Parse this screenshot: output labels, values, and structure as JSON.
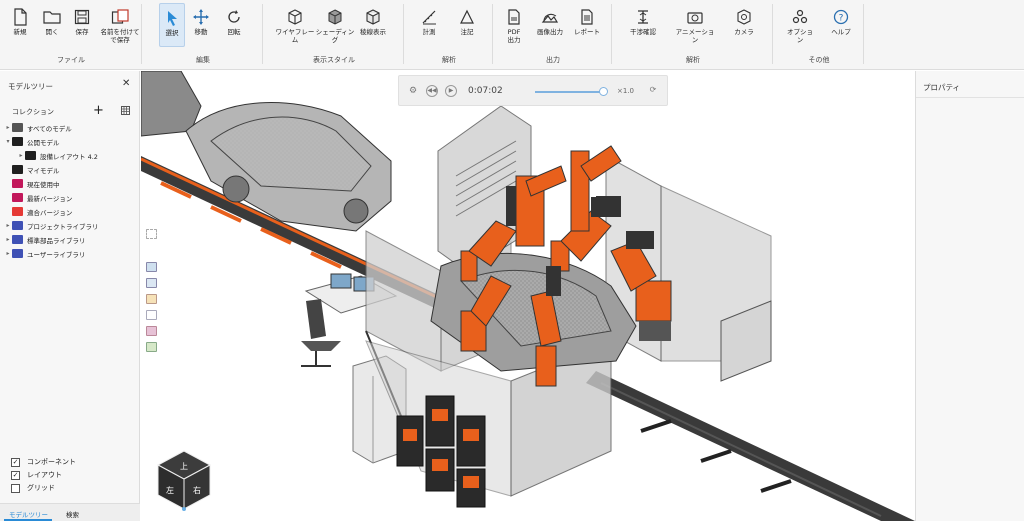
{
  "ribbon": {
    "groups": [
      {
        "label": "ファイル",
        "buttons": [
          {
            "label": "新規",
            "icon": "new-file-icon"
          },
          {
            "label": "開く",
            "icon": "open-folder-icon"
          },
          {
            "label": "保存",
            "icon": "save-icon"
          },
          {
            "label": "名前を付けて\nで保存",
            "icon": "save-as-icon"
          }
        ]
      },
      {
        "label": "編集",
        "buttons": [
          {
            "label": "選択",
            "icon": "select-arrow-icon"
          },
          {
            "label": "移動",
            "icon": "move-icon"
          },
          {
            "label": "回転",
            "icon": "rotate-icon"
          }
        ]
      },
      {
        "label": "表示スタイル",
        "buttons": [
          {
            "label": "ワイヤフレーム",
            "icon": "wireframe-cube-icon"
          },
          {
            "label": "シェーディング",
            "icon": "shaded-cube-icon"
          },
          {
            "label": "稜線表示",
            "icon": "edges-cube-icon"
          }
        ]
      },
      {
        "label": "解析",
        "buttons": [
          {
            "label": "計測",
            "icon": "measure-icon"
          },
          {
            "label": "注記",
            "icon": "annotation-icon"
          }
        ]
      },
      {
        "label": "出力",
        "buttons": [
          {
            "label": "PDF\n出力",
            "icon": "pdf-icon"
          },
          {
            "label": "画像出力",
            "icon": "image-export-icon"
          },
          {
            "label": "レポート",
            "icon": "report-icon"
          }
        ]
      },
      {
        "label": "解析",
        "buttons": [
          {
            "label": "干渉確認",
            "icon": "interference-icon"
          },
          {
            "label": "アニメーション",
            "icon": "animation-camera-icon"
          },
          {
            "label": "カメラ",
            "icon": "camera-icon"
          }
        ]
      },
      {
        "label": "その他",
        "buttons": [
          {
            "label": "オプション",
            "icon": "options-icon"
          },
          {
            "label": "ヘルプ",
            "icon": "help-icon"
          }
        ]
      }
    ]
  },
  "left_panel": {
    "title": "モデルツリー",
    "collection_label": "コレクション",
    "tree": [
      {
        "label": "すべてのモデル",
        "level": 0,
        "caret": "▸",
        "color": "#555555",
        "icon": "all-models-icon"
      },
      {
        "label": "公開モデル",
        "level": 0,
        "caret": "▾",
        "color": "#1f1f1f",
        "icon": "folder-icon"
      },
      {
        "label": "設備レイアウト 4.2",
        "level": 1,
        "caret": "▸",
        "color": "#1f1f1f",
        "icon": "folder-icon"
      },
      {
        "label": "マイモデル",
        "level": 0,
        "caret": "",
        "color": "#1f1f1f",
        "icon": "folder-icon"
      },
      {
        "label": "現在使用中",
        "level": 0,
        "caret": "",
        "color": "#c2185b",
        "icon": "folder-icon"
      },
      {
        "label": "最新バージョン",
        "level": 0,
        "caret": "",
        "color": "#c2185b",
        "icon": "folder-icon"
      },
      {
        "label": "適合バージョン",
        "level": 0,
        "caret": "",
        "color": "#e53935",
        "icon": "bar-chart-icon"
      },
      {
        "label": "プロジェクトライブラリ",
        "level": 0,
        "caret": "▸",
        "color": "#3f51b5",
        "icon": "library-icon"
      },
      {
        "label": "標準部品ライブラリ",
        "level": 0,
        "caret": "▸",
        "color": "#3f51b5",
        "icon": "library-icon"
      },
      {
        "label": "ユーザーライブラリ",
        "level": 0,
        "caret": "▸",
        "color": "#3f51b5",
        "icon": "library-icon"
      }
    ],
    "checkboxes": [
      {
        "label": "コンポーネント",
        "checked": true
      },
      {
        "label": "レイアウト",
        "checked": true
      },
      {
        "label": "グリッド",
        "checked": false
      }
    ],
    "tabs": [
      "モデルツリー",
      "検索"
    ],
    "active_tab": "モデルツリー"
  },
  "right_panel": {
    "title": "プロパティ"
  },
  "playback": {
    "time": "0:07:02",
    "speed": "×1.0",
    "progress": 0.96
  },
  "view_cube": {
    "top": "上",
    "left": "左",
    "right": "右"
  },
  "colors": {
    "accent": "#2a8bd6",
    "robot": "#e8601c",
    "fence": "#c9c9c9",
    "rail": "#3a3a3a"
  }
}
